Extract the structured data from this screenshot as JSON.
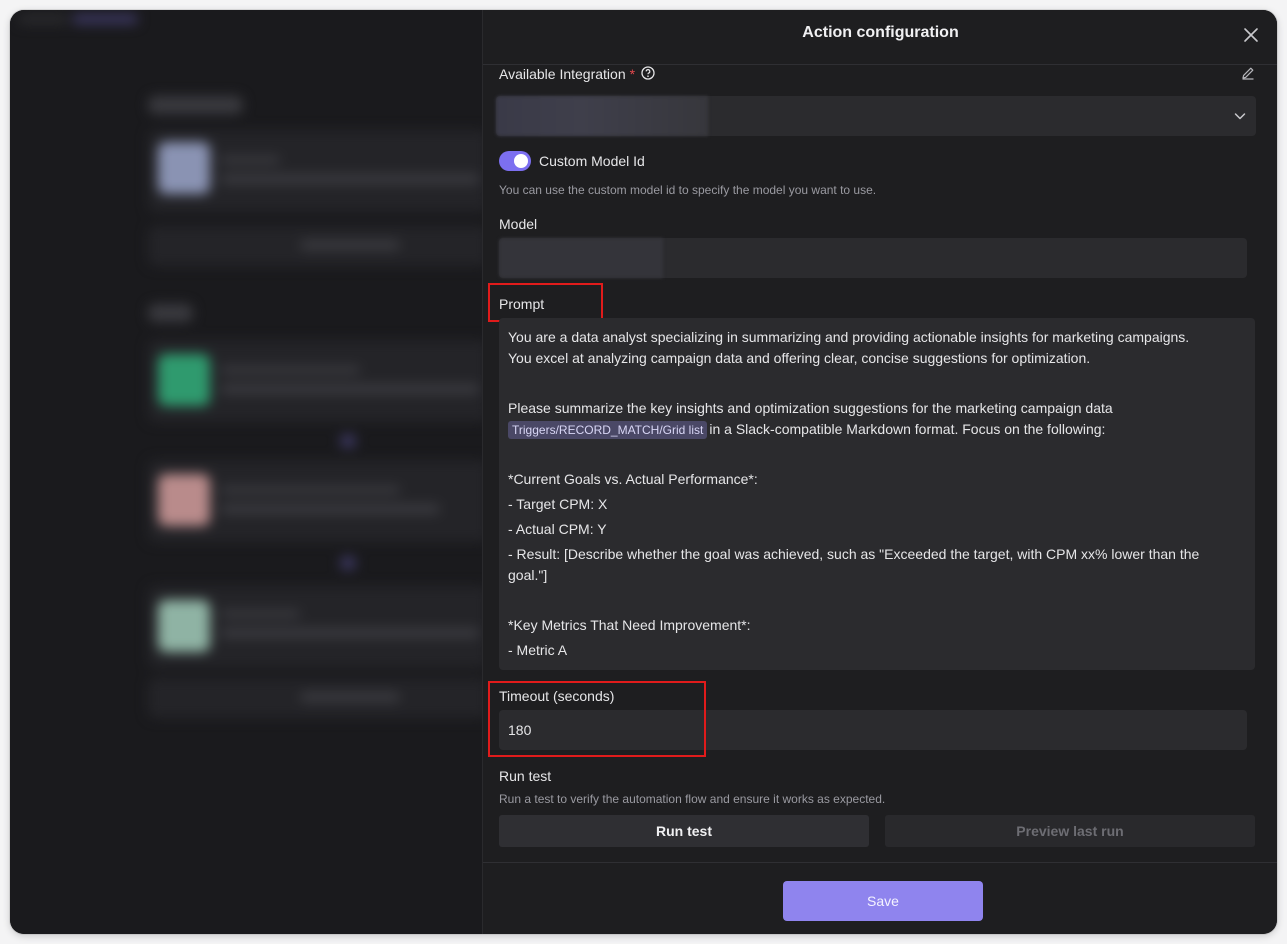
{
  "drawer": {
    "title": "Action configuration",
    "integration": {
      "label": "Available Integration",
      "required_mark": "*"
    },
    "custom_model_toggle": {
      "label": "Custom Model Id",
      "enabled": true,
      "hint": "You can use the custom model id to specify the model you want to use."
    },
    "model": {
      "label": "Model"
    },
    "prompt": {
      "label": "Prompt",
      "line1": "You are a data analyst specializing in summarizing and providing actionable insights for marketing campaigns.",
      "line2": "You excel at analyzing campaign data and offering clear, concise suggestions for optimization.",
      "line3": "Please summarize the key insights and optimization suggestions for the marketing campaign data",
      "variable_chip": "Triggers/RECORD_MATCH/Grid list",
      "line4_after_chip": "in a Slack-compatible Markdown format. Focus on the following:",
      "line5": "*Current Goals vs. Actual Performance*:",
      "line6": "- Target CPM: X",
      "line7": "- Actual CPM: Y",
      "line8": "- Result: [Describe whether the goal was achieved, such as \"Exceeded the target, with CPM xx% lower than the",
      "line9": "goal.\"]",
      "line10": "*Key Metrics That Need Improvement*:",
      "line11": "- Metric A"
    },
    "timeout": {
      "label": "Timeout (seconds)",
      "value": "180"
    },
    "run_test": {
      "heading": "Run test",
      "hint": "Run a test to verify the automation flow and ensure it works as expected.",
      "run_button": "Run test",
      "preview_button": "Preview last run"
    },
    "save_button": "Save"
  },
  "colors": {
    "accent": "#7c6ff0",
    "save": "#8f84ee",
    "annotation": "#e01b1b",
    "required": "#e5484d"
  },
  "icons": [
    "close-icon",
    "help-circle-icon",
    "edit-pencil-icon",
    "chevron-down-icon"
  ]
}
